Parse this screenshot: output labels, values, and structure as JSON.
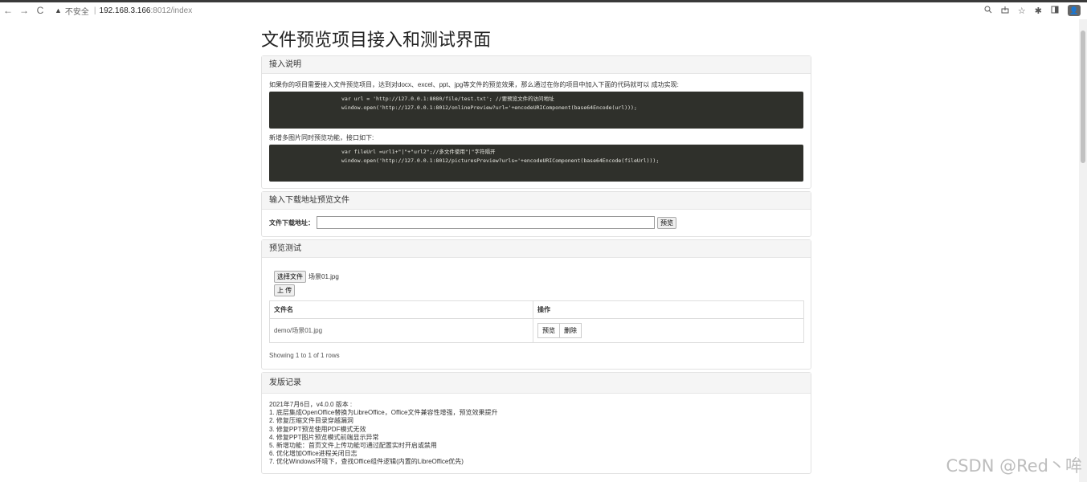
{
  "browser": {
    "nav_back": "←",
    "nav_forward": "→",
    "nav_reload": "C",
    "insecure_icon": "▲",
    "insecure_label": "不安全",
    "url_host": "192.168.3.166",
    "url_path": ":8012/index",
    "icons": [
      "zoom-icon",
      "share-icon",
      "star-icon",
      "extensions-icon",
      "sidebar-icon",
      "profile-icon"
    ]
  },
  "page": {
    "title": "文件预览项目接入和测试界面"
  },
  "access": {
    "heading": "接入说明",
    "desc1": "如果你的项目需要接入文件预览项目，达到对docx、excel、ppt、jpg等文件的预览效果，那么通过在你的项目中加入下面的代码就可以 成功实现:",
    "code1_line1": "var url = 'http://127.0.0.1:8080/file/test.txt'; //要预览文件的访问地址",
    "code1_line2": "window.open('http://127.0.0.1:8012/onlinePreview?url='+encodeURIComponent(base64Encode(url)));",
    "desc2": "新增多图片同时预览功能，接口如下:",
    "code2_line1": "var fileUrl =url1+\"|\"+\"url2\";//多文件使用\"|\"字符隔开",
    "code2_line2": "window.open('http://127.0.0.1:8012/picturesPreview?urls='+encodeURIComponent(base64Encode(fileUrl)));"
  },
  "download": {
    "heading": "输入下载地址预览文件",
    "label": "文件下载地址：",
    "input_value": "",
    "button": "预览"
  },
  "test": {
    "heading": "预览测试",
    "choose_button": "选择文件",
    "chosen_file": "场景01.jpg",
    "upload_button": "上 传",
    "col_name": "文件名",
    "col_action": "操作",
    "rows": [
      {
        "name": "demo/场景01.jpg",
        "preview": "预览",
        "delete": "删除"
      }
    ],
    "pagination": "Showing 1 to 1 of 1 rows"
  },
  "changelog": {
    "heading": "发版记录",
    "lines": [
      "2021年7月6日，v4.0.0 版本 :",
      "1. 底层集成OpenOffice替换为LibreOffice，Office文件兼容性增强，预览效果提升",
      "2. 修复压缩文件目录穿越漏洞",
      "3. 修复PPT预览使用PDF模式无效",
      "4. 修复PPT图片预览模式前端显示异常",
      "5. 新增功能：首页文件上传功能可通过配置实时开启或禁用",
      "6. 优化增加Office进程关闭日志",
      "7. 优化Windows环境下，查找Office组件逻辑(内置的LibreOffice优先)"
    ]
  },
  "watermark": "CSDN @Red丶哞"
}
